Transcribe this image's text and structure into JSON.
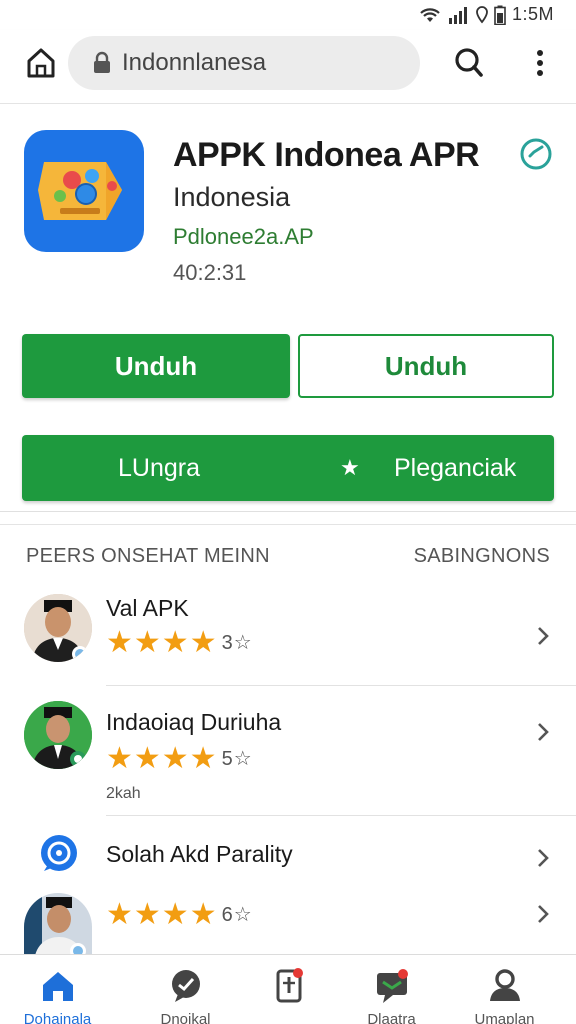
{
  "status_bar": {
    "time": "1:5M"
  },
  "search": {
    "query": "Indonnlanesa"
  },
  "app": {
    "title": "APPK Indonea APR",
    "subtitle": "Indonesia",
    "developer": "Pdlonee2a.AP",
    "meta": "40:2:31",
    "accent_color": "#1e9a3e",
    "primary_button": "Unduh",
    "secondary_button": "Unduh",
    "wide_button_left": "LUngra",
    "wide_button_star": "★",
    "wide_button_right": "Pleganciak"
  },
  "section": {
    "left_header": "PEERS ONSEHAT MEINN",
    "right_header": "SABINGNONS",
    "items": [
      {
        "title": "Val APK",
        "rating": "3.5",
        "count": "3☆",
        "sub": ""
      },
      {
        "title": "Indaoiaq Duriuha",
        "rating": "4",
        "count": "5☆",
        "sub": "2kah"
      },
      {
        "title": "Solah Akd Parality",
        "rating": "",
        "count": "",
        "sub": ""
      },
      {
        "title": "",
        "rating": "4.5",
        "count": "6☆",
        "sub": ""
      }
    ]
  },
  "bottom_nav": {
    "active_color": "#1e6fd9",
    "items": [
      {
        "label": "Dohainala",
        "icon": "home-icon"
      },
      {
        "label": "Dnoikal",
        "icon": "chat-icon"
      },
      {
        "label": "",
        "icon": "bookmark-icon"
      },
      {
        "label": "Dlaatra",
        "icon": "message-icon"
      },
      {
        "label": "Umaplan",
        "icon": "profile-icon"
      }
    ]
  }
}
